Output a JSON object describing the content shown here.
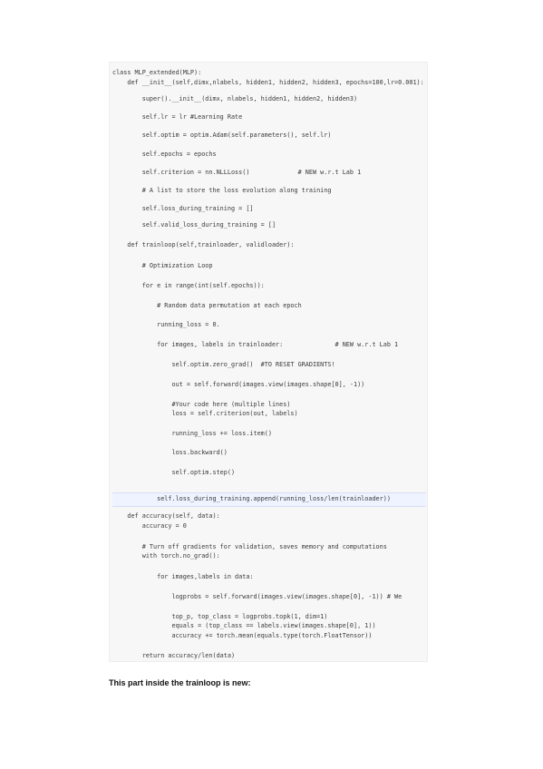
{
  "code": {
    "lines": [
      "class MLP_extended(MLP):",
      "    def __init__(self,dimx,nlabels, hidden1, hidden2, hidden3, epochs=100,lr=0.001):",
      "        super().__init__(dimx, nlabels, hidden1, hidden2, hidden3)",
      "        self.lr = lr #Learning Rate",
      "        self.optim = optim.Adam(self.parameters(), self.lr)",
      "        self.epochs = epochs",
      "        self.criterion = nn.NLLLoss()             # NEW w.r.t Lab 1",
      "        # A list to store the loss evolution along training",
      "        self.loss_during_training = []",
      "        self.valid_loss_during_training = []",
      "    def trainloop(self,trainloader, validloader):",
      "        # Optimization Loop",
      "        for e in range(int(self.epochs)):",
      "            # Random data permutation at each epoch",
      "            running_loss = 0.",
      "            for images, labels in trainloader:              # NEW w.r.t Lab 1",
      "                self.optim.zero_grad()  #TO RESET GRADIENTS!",
      "                out = self.forward(images.view(images.shape[0], -1))",
      "                #Your code here (multiple lines)",
      "                loss = self.criterion(out, labels)",
      "                running_loss += loss.item()",
      "                loss.backward()",
      "                self.optim.step()",
      "            self.loss_during_training.append(running_loss/len(trainloader))",
      "    def accuracy(self, data):",
      "        accuracy = 0",
      "        # Turn off gradients for validation, saves memory and computations",
      "        with torch.no_grad():",
      "            for images,labels in data:",
      "                logprobs = self.forward(images.view(images.shape[0], -1)) # We",
      "                top_p, top_class = logprobs.topk(1, dim=1)",
      "                equals = (top_class == labels.view(images.shape[0], 1))",
      "                accuracy += torch.mean(equals.type(torch.FloatTensor))",
      "        return accuracy/len(data)"
    ]
  },
  "note": {
    "text": "This part inside the trainloop is new:"
  }
}
